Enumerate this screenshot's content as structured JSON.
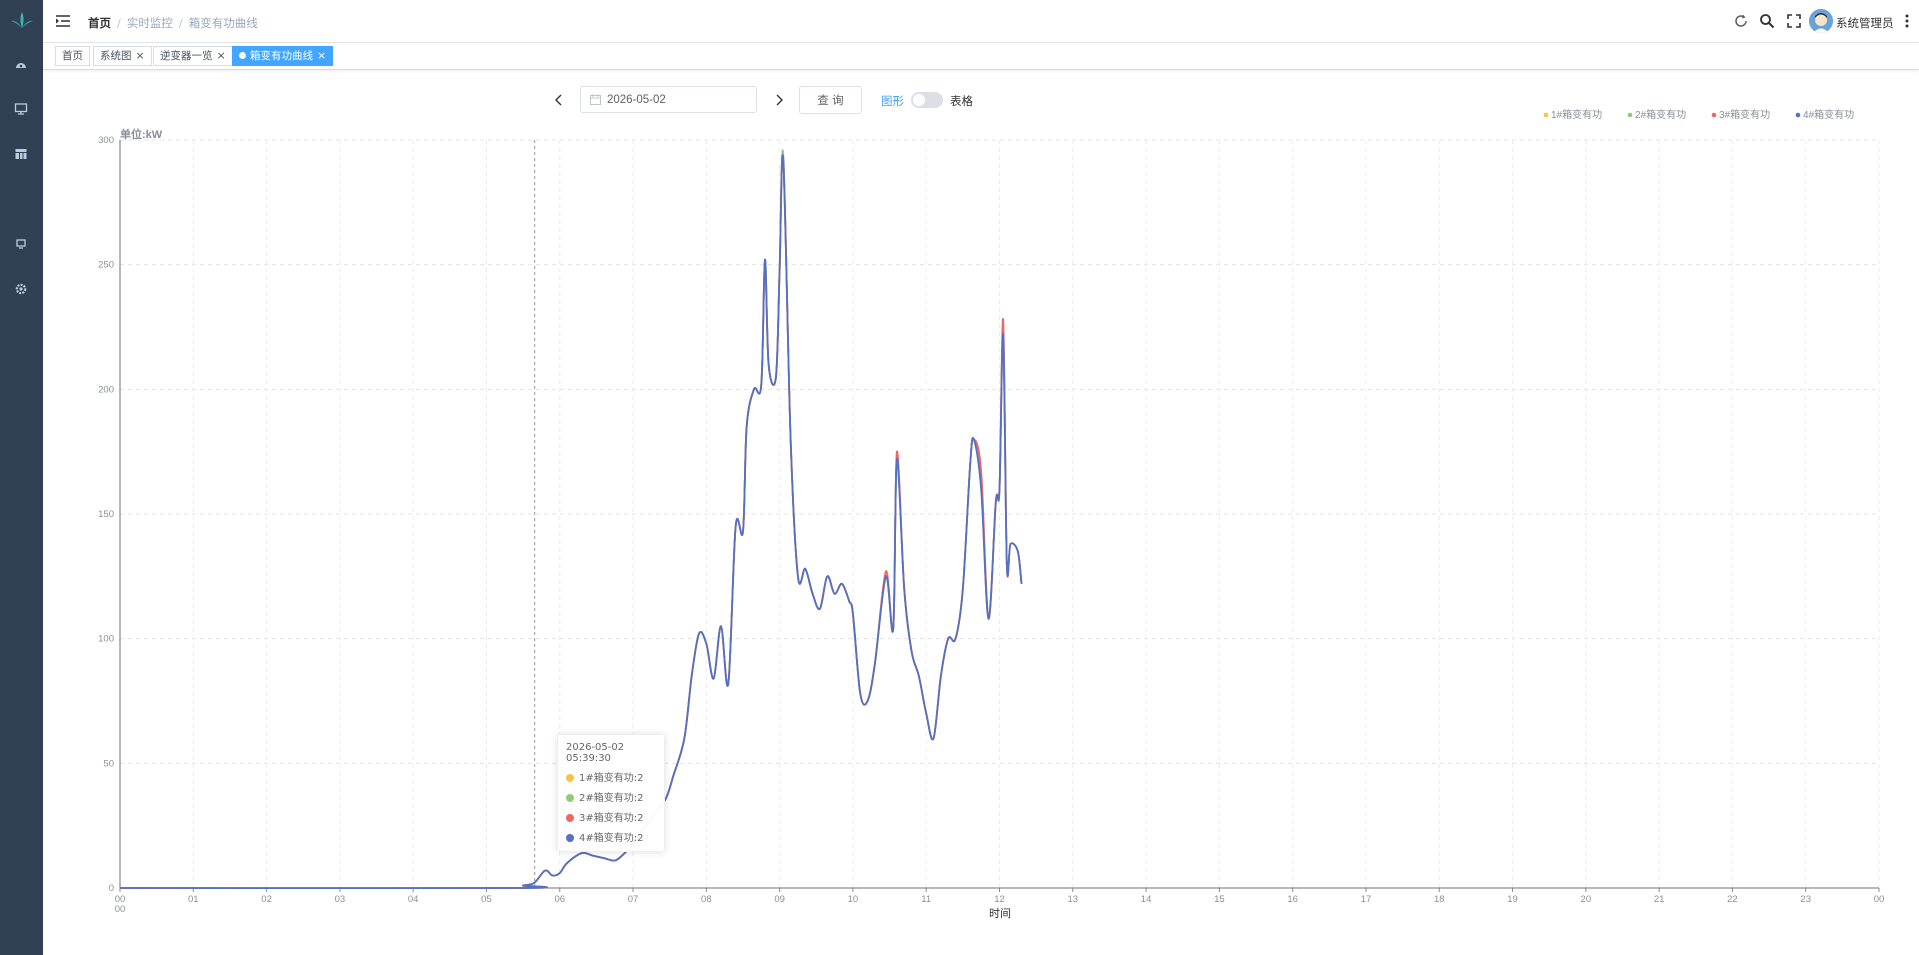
{
  "header": {
    "breadcrumb": [
      "首页",
      "实时监控",
      "箱变有功曲线"
    ],
    "username": "系统管理员"
  },
  "sidebar": {
    "items": [
      {
        "icon": "dashboard-icon"
      },
      {
        "icon": "monitor-icon"
      },
      {
        "icon": "table-icon"
      },
      {
        "icon": "report-icon"
      },
      {
        "icon": "gear-icon"
      }
    ]
  },
  "tags": [
    {
      "label": "首页",
      "closable": false,
      "active": false
    },
    {
      "label": "系统图",
      "closable": true,
      "active": false
    },
    {
      "label": "逆变器一览",
      "closable": true,
      "active": false
    },
    {
      "label": "箱变有功曲线",
      "closable": true,
      "active": true
    }
  ],
  "toolbar": {
    "date": "2026-05-02",
    "query_label": "查 询",
    "graph_label": "图形",
    "table_label": "表格"
  },
  "chart_data": {
    "type": "line",
    "unit_label": "单位:kW",
    "xlabel": "时间",
    "x_ticks": [
      "00\n00",
      "01",
      "02",
      "03",
      "04",
      "05",
      "06",
      "07",
      "08",
      "09",
      "10",
      "11",
      "12",
      "13",
      "14",
      "15",
      "16",
      "17",
      "18",
      "19",
      "20",
      "21",
      "22",
      "23",
      "00"
    ],
    "ylim": [
      0,
      300
    ],
    "y_ticks": [
      0,
      50,
      100,
      150,
      200,
      250,
      300
    ],
    "legend_position": "top-right",
    "grid": true,
    "x_hours": [
      0,
      5.4,
      5.5,
      5.65,
      5.8,
      5.9,
      6.0,
      6.1,
      6.3,
      6.45,
      6.6,
      6.75,
      6.85,
      6.95,
      7.1,
      7.3,
      7.45,
      7.55,
      7.7,
      7.8,
      7.9,
      8.0,
      8.1,
      8.2,
      8.3,
      8.4,
      8.5,
      8.55,
      8.65,
      8.75,
      8.8,
      8.85,
      8.95,
      9.0,
      9.05,
      9.15,
      9.25,
      9.35,
      9.45,
      9.55,
      9.65,
      9.75,
      9.85,
      9.95,
      10.0,
      10.1,
      10.2,
      10.3,
      10.45,
      10.55,
      10.6,
      10.7,
      10.8,
      10.9,
      11.0,
      11.1,
      11.2,
      11.3,
      11.4,
      11.5,
      11.6,
      11.65,
      11.75,
      11.85,
      11.95,
      12.0,
      12.05,
      12.1,
      12.15,
      12.25,
      12.3
    ],
    "series": [
      {
        "name": "1#箱变有功",
        "color": "#f7c344",
        "values": [
          0,
          0,
          1,
          2,
          7,
          5,
          6,
          10,
          14,
          13,
          12,
          11,
          13,
          16,
          22,
          30,
          36,
          45,
          60,
          85,
          102,
          98,
          84,
          105,
          82,
          145,
          143,
          185,
          200,
          202,
          252,
          210,
          205,
          248,
          292,
          180,
          125,
          128,
          118,
          112,
          125,
          118,
          122,
          115,
          110,
          78,
          75,
          90,
          125,
          104,
          172,
          120,
          95,
          85,
          70,
          60,
          85,
          100,
          100,
          120,
          170,
          180,
          160,
          108,
          155,
          160,
          222,
          130,
          138,
          135,
          122
        ]
      },
      {
        "name": "2#箱变有功",
        "color": "#91cc75",
        "values": [
          0,
          0,
          1,
          2,
          7,
          5,
          6,
          10,
          14,
          13,
          12,
          11,
          13,
          16,
          22,
          30,
          36,
          45,
          60,
          85,
          102,
          98,
          84,
          105,
          82,
          145,
          143,
          185,
          200,
          202,
          252,
          210,
          205,
          248,
          294,
          180,
          125,
          128,
          118,
          112,
          125,
          118,
          122,
          115,
          110,
          78,
          75,
          90,
          125,
          104,
          172,
          120,
          95,
          85,
          70,
          60,
          85,
          100,
          100,
          120,
          170,
          180,
          162,
          108,
          155,
          160,
          222,
          130,
          138,
          135,
          122
        ]
      },
      {
        "name": "3#箱变有功",
        "color": "#ee6666",
        "values": [
          0,
          0,
          1,
          2,
          7,
          5,
          6,
          10,
          14,
          13,
          12,
          11,
          13,
          16,
          22,
          30,
          36,
          45,
          60,
          85,
          102,
          98,
          84,
          105,
          82,
          145,
          143,
          185,
          200,
          202,
          252,
          210,
          205,
          248,
          292,
          180,
          125,
          128,
          118,
          112,
          125,
          118,
          122,
          115,
          110,
          78,
          75,
          90,
          127,
          104,
          175,
          120,
          95,
          85,
          70,
          60,
          85,
          100,
          100,
          120,
          170,
          180,
          167,
          108,
          155,
          160,
          228,
          130,
          138,
          135,
          122
        ]
      },
      {
        "name": "4#箱变有功",
        "color": "#5470c6",
        "values": [
          0,
          0,
          1,
          2,
          7,
          5,
          6,
          10,
          14,
          13,
          12,
          11,
          13,
          16,
          22,
          30,
          36,
          45,
          60,
          85,
          102,
          98,
          84,
          105,
          82,
          145,
          143,
          185,
          200,
          202,
          252,
          210,
          205,
          248,
          292,
          180,
          125,
          128,
          118,
          112,
          125,
          118,
          122,
          115,
          110,
          78,
          75,
          90,
          125,
          104,
          172,
          120,
          95,
          85,
          70,
          60,
          85,
          100,
          100,
          120,
          170,
          180,
          160,
          108,
          155,
          160,
          222,
          130,
          138,
          135,
          122
        ]
      }
    ],
    "tooltip": {
      "time": "2026-05-02 05:39:30",
      "rows": [
        "1#箱变有功:2",
        "2#箱变有功:2",
        "3#箱变有功:2",
        "4#箱变有功:2"
      ],
      "x_hour": 5.658
    }
  }
}
